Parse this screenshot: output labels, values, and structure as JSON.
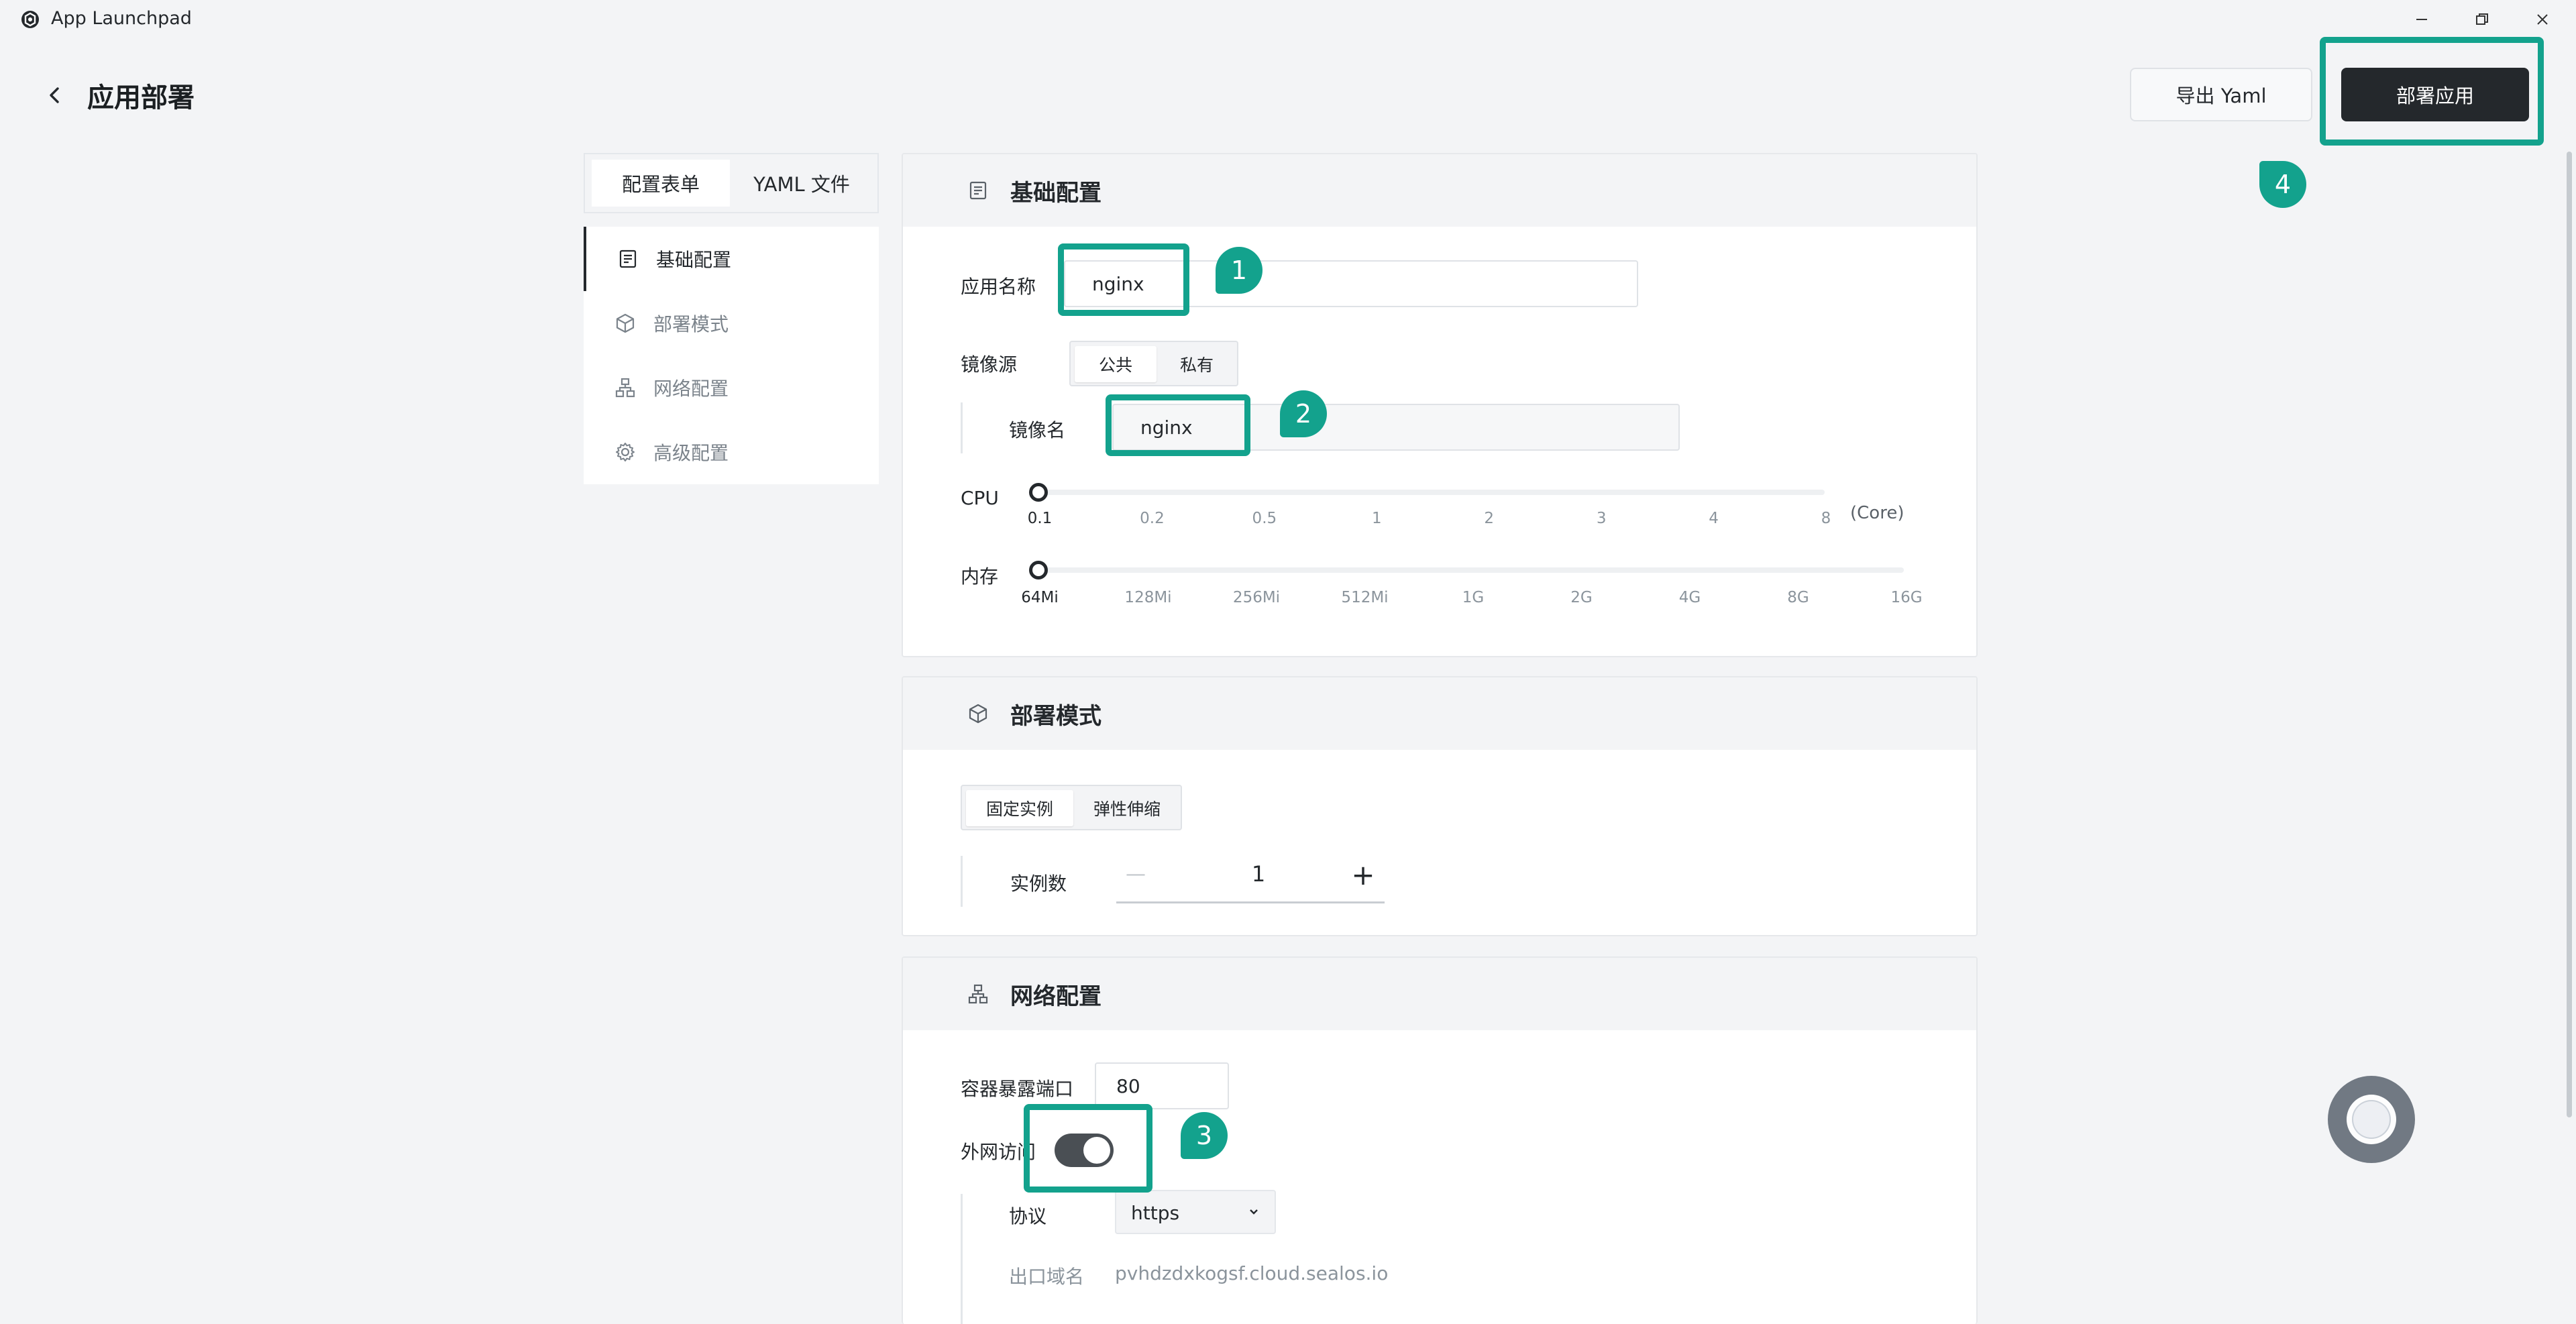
{
  "window": {
    "title": "App Launchpad",
    "minimize_icon": "minimize-icon",
    "restore_icon": "restore-icon",
    "close_icon": "close-icon"
  },
  "header": {
    "title": "应用部署",
    "export_label": "导出 Yaml",
    "deploy_label": "部署应用"
  },
  "tabs": [
    "配置表单",
    "YAML 文件"
  ],
  "nav": {
    "items": [
      {
        "label": "基础配置",
        "icon": "document-icon"
      },
      {
        "label": "部署模式",
        "icon": "cube-icon"
      },
      {
        "label": "网络配置",
        "icon": "network-icon"
      },
      {
        "label": "高级配置",
        "icon": "gear-icon"
      }
    ]
  },
  "basic": {
    "title": "基础配置",
    "app_name_label": "应用名称",
    "app_name_value": "nginx",
    "image_source_label": "镜像源",
    "image_source_options": [
      "公共",
      "私有"
    ],
    "image_source_selected": "公共",
    "image_name_label": "镜像名",
    "image_name_value": "nginx",
    "cpu_label": "CPU",
    "cpu_unit": "(Core)",
    "cpu_ticks": [
      "0.1",
      "0.2",
      "0.5",
      "1",
      "2",
      "3",
      "4",
      "8"
    ],
    "cpu_value": "0.1",
    "memory_label": "内存",
    "memory_ticks": [
      "64Mi",
      "128Mi",
      "256Mi",
      "512Mi",
      "1G",
      "2G",
      "4G",
      "8G",
      "16G"
    ],
    "memory_value": "64Mi"
  },
  "mode": {
    "title": "部署模式",
    "options": [
      "固定实例",
      "弹性伸缩"
    ],
    "selected": "固定实例",
    "instances_label": "实例数",
    "instances_value": "1",
    "minus": "—",
    "plus": "+"
  },
  "network": {
    "title": "网络配置",
    "port_label": "容器暴露端口",
    "port_value": "80",
    "public_access_label": "外网访问",
    "public_access_enabled": true,
    "protocol_label": "协议",
    "protocol_value": "https",
    "domain_label": "出口域名",
    "domain_value": "pvhdzdxkogsf.cloud.sealos.io"
  },
  "annotations": [
    "1",
    "2",
    "3",
    "4"
  ],
  "colors": {
    "accent": "#13a28d",
    "dark": "#24282c",
    "background": "#f3f4f6"
  }
}
